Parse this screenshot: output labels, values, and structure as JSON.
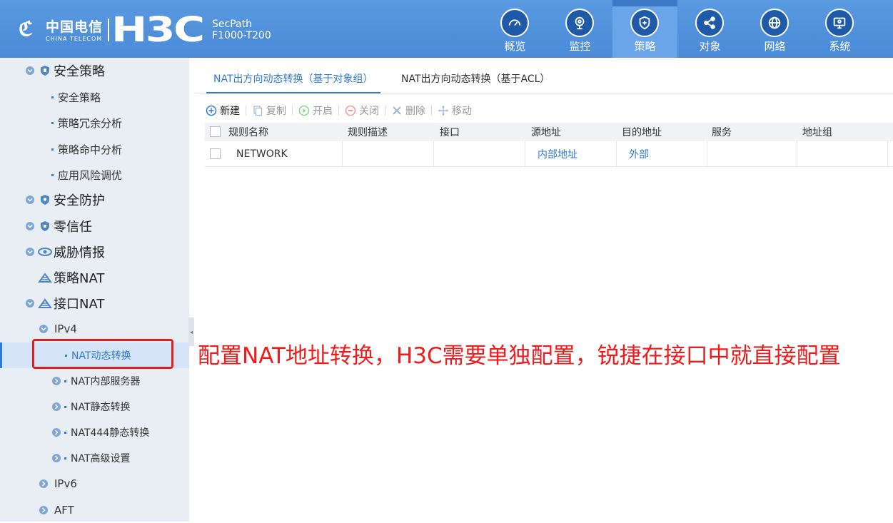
{
  "header": {
    "telecom_mark": "ℭ",
    "telecom_cn": "中国电信",
    "telecom_en": "CHINA TELECOM",
    "brand": "H3C",
    "product_line1": "SecPath",
    "product_line2": "F1000-T200",
    "nav": [
      {
        "label": "概览",
        "icon": "gauge-icon"
      },
      {
        "label": "监控",
        "icon": "camera-icon"
      },
      {
        "label": "策略",
        "icon": "shield-icon",
        "active": true
      },
      {
        "label": "对象",
        "icon": "share-icon"
      },
      {
        "label": "网络",
        "icon": "globe-icon"
      },
      {
        "label": "系统",
        "icon": "monitor-icon"
      }
    ]
  },
  "sidebar": {
    "items": [
      {
        "label": "安全策略"
      },
      {
        "label": "安全策略"
      },
      {
        "label": "策略冗余分析"
      },
      {
        "label": "策略命中分析"
      },
      {
        "label": "应用风险调优"
      },
      {
        "label": "安全防护"
      },
      {
        "label": "零信任"
      },
      {
        "label": "威胁情报"
      },
      {
        "label": "策略NAT"
      },
      {
        "label": "接口NAT"
      },
      {
        "label": "IPv4"
      },
      {
        "label": "NAT动态转换",
        "selected": true
      },
      {
        "label": "NAT内部服务器"
      },
      {
        "label": "NAT静态转换"
      },
      {
        "label": "NAT444静态转换"
      },
      {
        "label": "NAT高级设置"
      },
      {
        "label": "IPv6"
      },
      {
        "label": "AFT"
      }
    ],
    "collapse_glyph": "◂"
  },
  "main": {
    "tabs": [
      {
        "label": "NAT出方向动态转换（基于对象组）",
        "active": true
      },
      {
        "label": "NAT出方向动态转换（基于ACL）"
      }
    ],
    "toolbar": {
      "new": "新建",
      "copy": "复制",
      "enable": "开启",
      "disable": "关闭",
      "delete": "删除",
      "move": "移动"
    },
    "table": {
      "columns": [
        "规则名称",
        "规则描述",
        "接口",
        "源地址",
        "目的地址",
        "服务",
        "地址组"
      ],
      "rows": [
        [
          "NETWORK",
          "",
          "",
          "内部地址",
          "外部",
          "",
          ""
        ]
      ]
    }
  },
  "annotation": {
    "text": "配置NAT地址转换，H3C需要单独配置，锐捷在接口中就直接配置",
    "color": "#ee1c1c"
  }
}
